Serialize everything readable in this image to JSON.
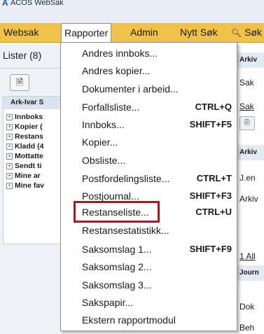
{
  "window": {
    "title": "ACOS WebSak",
    "logo": "A"
  },
  "menubar": {
    "items": [
      {
        "label": "Websak"
      },
      {
        "label": "Rapporter"
      },
      {
        "label": "Admin"
      },
      {
        "label": "Nytt Søk"
      },
      {
        "label": "Søk",
        "icon": "search-icon"
      }
    ]
  },
  "left_panel": {
    "lister_label": "Lister (8)",
    "tree_header": "Ark-Ivar S",
    "tree_items": [
      "Innboks",
      "Kopier (",
      "Restans",
      "Kladd (4",
      "Mottatte",
      "Sendt ti",
      "Mine ar",
      "Mine fav"
    ]
  },
  "rapporter_menu": {
    "items": [
      {
        "label": "Andres innboks...",
        "shortcut": ""
      },
      {
        "label": "Andres kopier...",
        "shortcut": ""
      },
      {
        "label": "Dokumenter i arbeid...",
        "shortcut": ""
      },
      {
        "label": "Forfallsliste...",
        "shortcut": "CTRL+Q"
      },
      {
        "label": "Innboks...",
        "shortcut": "SHIFT+F5"
      },
      {
        "label": "Kopier...",
        "shortcut": ""
      },
      {
        "label": "Obsliste...",
        "shortcut": ""
      },
      {
        "label": "Postfordelingsliste...",
        "shortcut": "CTRL+T"
      },
      {
        "label": "Postjournal...",
        "shortcut": "SHIFT+F3"
      },
      {
        "label": "Restanseliste...",
        "shortcut": "CTRL+U",
        "highlighted": true
      },
      {
        "label": "Restansestatistikk...",
        "shortcut": ""
      },
      {
        "label": "Saksomslag 1...",
        "shortcut": "SHIFT+F9"
      },
      {
        "label": "Saksomslag 2...",
        "shortcut": ""
      },
      {
        "label": "Saksomslag 3...",
        "shortcut": ""
      },
      {
        "label": "Sakspapir...",
        "shortcut": ""
      },
      {
        "label": "Ekstern rapportmodul",
        "shortcut": ""
      }
    ],
    "highlight_color": "#d0021b"
  },
  "right_panel": {
    "arkiv_header": "Arkiv",
    "sak_label_1": "Sak",
    "sak_label_2": "Sak",
    "arkiv_header_2": "Arkiv",
    "jen_label": "J.en",
    "arkiv_label": "Arkiv",
    "all_label": "1 All",
    "journal_header": "Journ",
    "dok_label": "Dok",
    "beh_label": "Beh"
  },
  "colors": {
    "menubar": "#f1c24a",
    "titlebar": "#e9eef4",
    "panel": "#eef1f5"
  }
}
